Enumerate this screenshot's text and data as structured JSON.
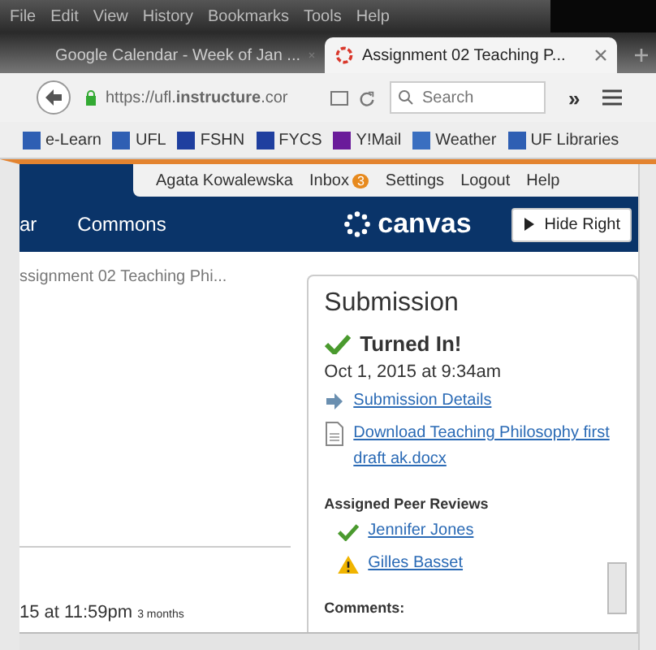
{
  "menu_bar": [
    "File",
    "Edit",
    "View",
    "History",
    "Bookmarks",
    "Tools",
    "Help"
  ],
  "tabs": [
    {
      "label": "Google Calendar - Week of Jan ...",
      "selected": false
    },
    {
      "label": "Assignment 02 Teaching P...",
      "selected": true
    }
  ],
  "nav": {
    "url": "https://ufl.**instructure**.cor",
    "search": {
      "placeholder": "Search"
    },
    "overflow": "»"
  },
  "bookmarks": [
    {
      "label": "e-Learn",
      "color": "#2f5fb3"
    },
    {
      "label": "UFL",
      "color": "#2f5fb3"
    },
    {
      "label": "FSHN",
      "color": "#1f3f9f"
    },
    {
      "label": "FYCS",
      "color": "#1f3f9f"
    },
    {
      "label": "Y!Mail",
      "color": "#6a1b9a"
    },
    {
      "label": "Weather",
      "color": "#3a6fc0"
    },
    {
      "label": "UF Libraries",
      "color": "#2f5fb3"
    }
  ],
  "user_menu": [
    {
      "label": "Agata Kowalewska"
    },
    {
      "label": "Inbox",
      "badge": "3"
    },
    {
      "label": "Settings"
    },
    {
      "label": "Logout"
    },
    {
      "label": "Help"
    }
  ],
  "global_nav": [
    "ar",
    "Commons"
  ],
  "logo": "canvas",
  "hide_right": "Hide Right",
  "breadcrumb": "ssignment 02 Teaching Phi...",
  "due": {
    "text": "15 at 11:59pm",
    "ago": "3 months"
  },
  "submission": {
    "title": "Submission",
    "status": "Turned In!",
    "date": "Oct 1, 2015 at 9:34am",
    "details": "Submission Details",
    "download": "Download Teaching Philosophy first draft ak.docx",
    "peer_title": "Assigned Peer Reviews",
    "peers": [
      {
        "name": "Jennifer Jones",
        "kind": "done"
      },
      {
        "name": "Gilles Basset",
        "kind": "pending"
      }
    ],
    "comments": "Comments:"
  }
}
